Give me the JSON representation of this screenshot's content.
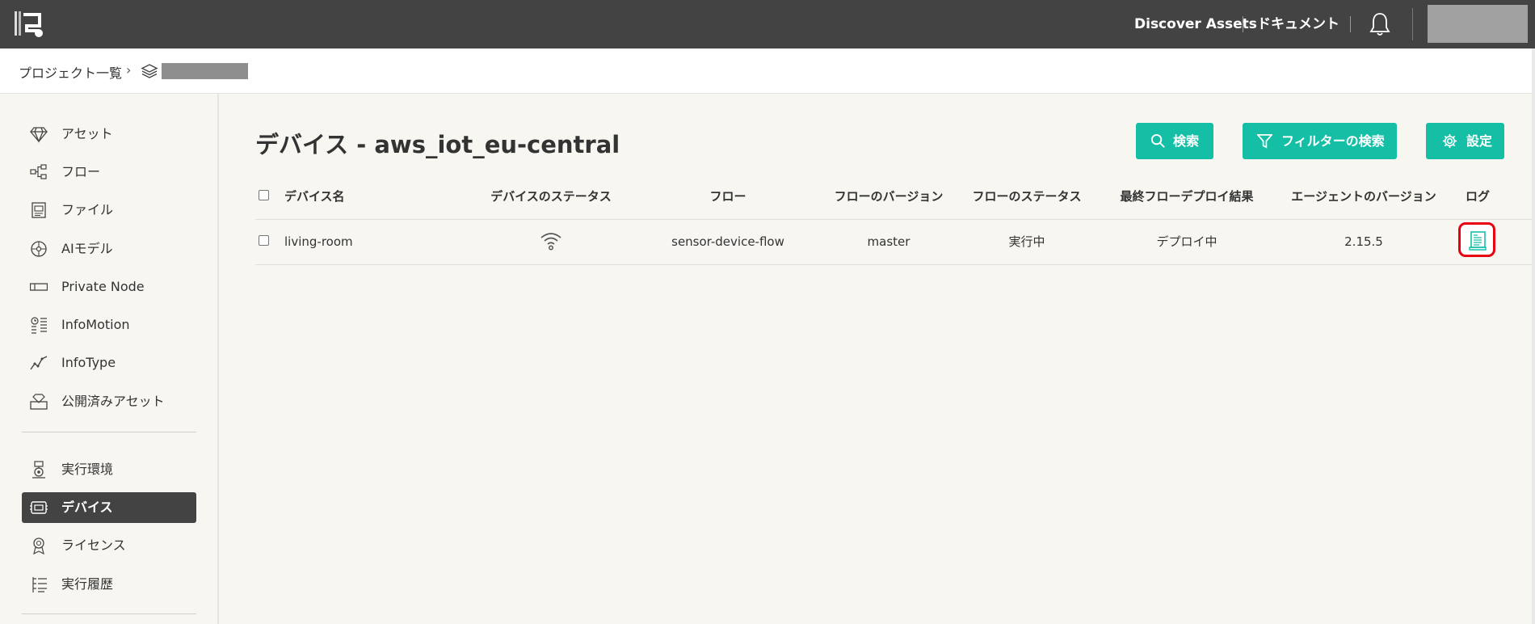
{
  "header": {
    "discover_assets": "Discover Assets",
    "documents": "ドキュメント",
    "icons": [
      "logo-icon",
      "bell-icon"
    ]
  },
  "breadcrumb": {
    "projects": "プロジェクト一覧",
    "separator": "›"
  },
  "sidebar": {
    "items": [
      {
        "label": "アセット",
        "icon": "gem-icon"
      },
      {
        "label": "フロー",
        "icon": "flow-icon"
      },
      {
        "label": "ファイル",
        "icon": "file-icon"
      },
      {
        "label": "AIモデル",
        "icon": "ai-model-icon"
      },
      {
        "label": "Private Node",
        "icon": "private-node-icon"
      },
      {
        "label": "InfoMotion",
        "icon": "infomotion-icon"
      },
      {
        "label": "InfoType",
        "icon": "infotype-icon"
      },
      {
        "label": "公開済みアセット",
        "icon": "published-assets-icon"
      },
      {
        "label": "実行環境",
        "icon": "runtime-icon"
      },
      {
        "label": "デバイス",
        "icon": "device-icon",
        "active": true
      },
      {
        "label": "ライセンス",
        "icon": "license-icon"
      },
      {
        "label": "実行履歴",
        "icon": "history-icon"
      }
    ]
  },
  "main": {
    "title": "デバイス - aws_iot_eu-central",
    "buttons": {
      "search": "検索",
      "filter_search": "フィルターの検索",
      "settings": "設定"
    },
    "table": {
      "columns": [
        "デバイス名",
        "デバイスのステータス",
        "フロー",
        "フローのバージョン",
        "フローのステータス",
        "最終フローデプロイ結果",
        "エージェントのバージョン",
        "ログ"
      ],
      "rows": [
        {
          "device_name": "living-room",
          "status_icon": "wifi-icon",
          "flow": "sensor-device-flow",
          "flow_version": "master",
          "flow_status": "実行中",
          "last_deploy_result": "デプロイ中",
          "agent_version": "2.15.5",
          "log_icon": "log-icon"
        }
      ]
    }
  },
  "colors": {
    "topbar": "#434343",
    "accent": "#15bfa6",
    "highlight": "#e60012",
    "background": "#f7f6f1"
  }
}
